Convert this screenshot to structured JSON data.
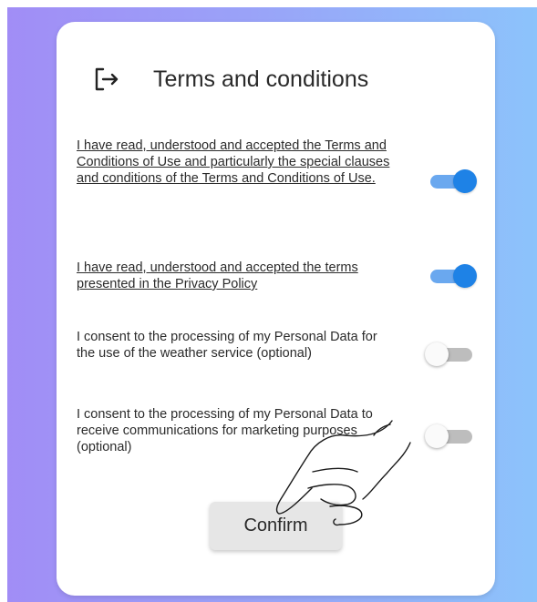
{
  "dialog": {
    "title": "Terms and conditions",
    "header_icon": "logout-arrow-icon",
    "confirm_label": "Confirm"
  },
  "consents": [
    {
      "text": "I have read, understood and accepted the Terms and Conditions of Use and particularly the special clauses and conditions of the Terms and Conditions of Use.",
      "is_link": true,
      "enabled": true
    },
    {
      "text": "I have read, understood and accepted the terms presented in the Privacy Policy",
      "is_link": true,
      "enabled": true
    },
    {
      "text": "I consent to the processing of my Personal Data for the use of the weather service (optional)",
      "is_link": false,
      "enabled": false
    },
    {
      "text": "I consent to the processing of my Personal Data to receive communications for marketing purposes (optional)",
      "is_link": false,
      "enabled": false
    }
  ],
  "colors": {
    "toggle_on_thumb": "#1e82e6",
    "toggle_on_track": "#6aa8ef",
    "toggle_off_track": "#bdbdbd",
    "background_left": "#a18df6",
    "background_right": "#8cc3fb"
  },
  "overlay": {
    "icon": "pointing-hand-icon"
  }
}
